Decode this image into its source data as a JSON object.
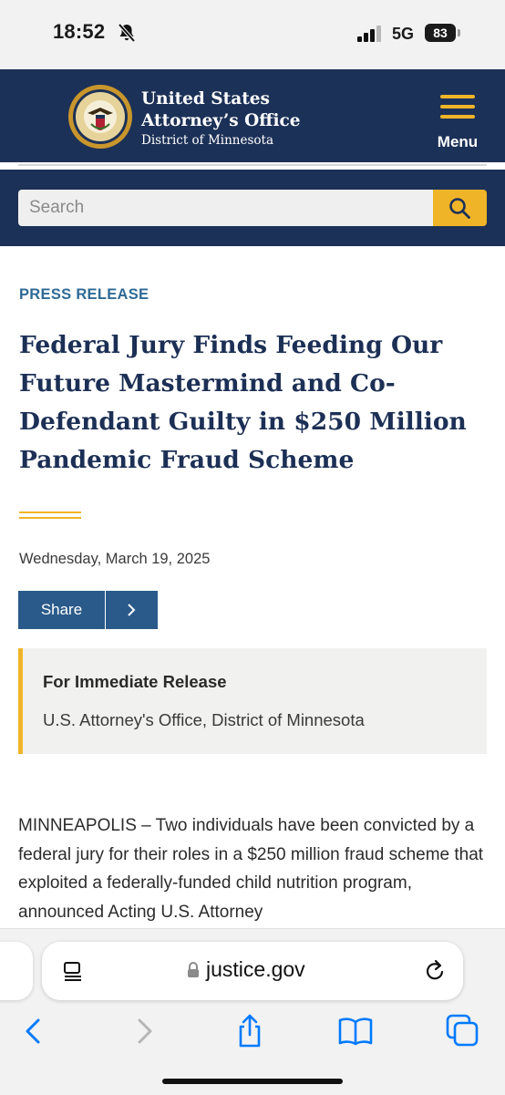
{
  "status_bar": {
    "time": "18:52",
    "network": "5G",
    "battery": "83",
    "icons": [
      "bell-slash-icon",
      "signal-icon",
      "battery-icon"
    ]
  },
  "header": {
    "org_line1": "United States",
    "org_line2": "Attorney’s Office",
    "org_sub": "District of Minnesota",
    "menu_label": "Menu",
    "colors": {
      "navy": "#1c3157",
      "gold": "#f0b429"
    }
  },
  "search": {
    "placeholder": "Search",
    "icon": "search-icon"
  },
  "article": {
    "eyebrow": "PRESS RELEASE",
    "headline": "Federal Jury Finds Feeding Our Future Mastermind and Co-Defendant Guilty in $250 Million Pandemic Fraud Scheme",
    "date": "Wednesday, March 19, 2025",
    "share_label": "Share",
    "notice_title": "For Immediate Release",
    "notice_sub": "U.S. Attorney's Office, District of Minnesota",
    "body": "MINNEAPOLIS – Two individuals have been convicted by a federal jury for their roles in a $250 million fraud scheme that exploited a federally-funded child nutrition program, announced Acting U.S. Attorney"
  },
  "browser": {
    "url": "justice.gov",
    "toolbar": [
      "back-icon",
      "forward-icon",
      "share-icon",
      "bookmarks-icon",
      "tabs-icon"
    ],
    "accent": "#007aff"
  }
}
